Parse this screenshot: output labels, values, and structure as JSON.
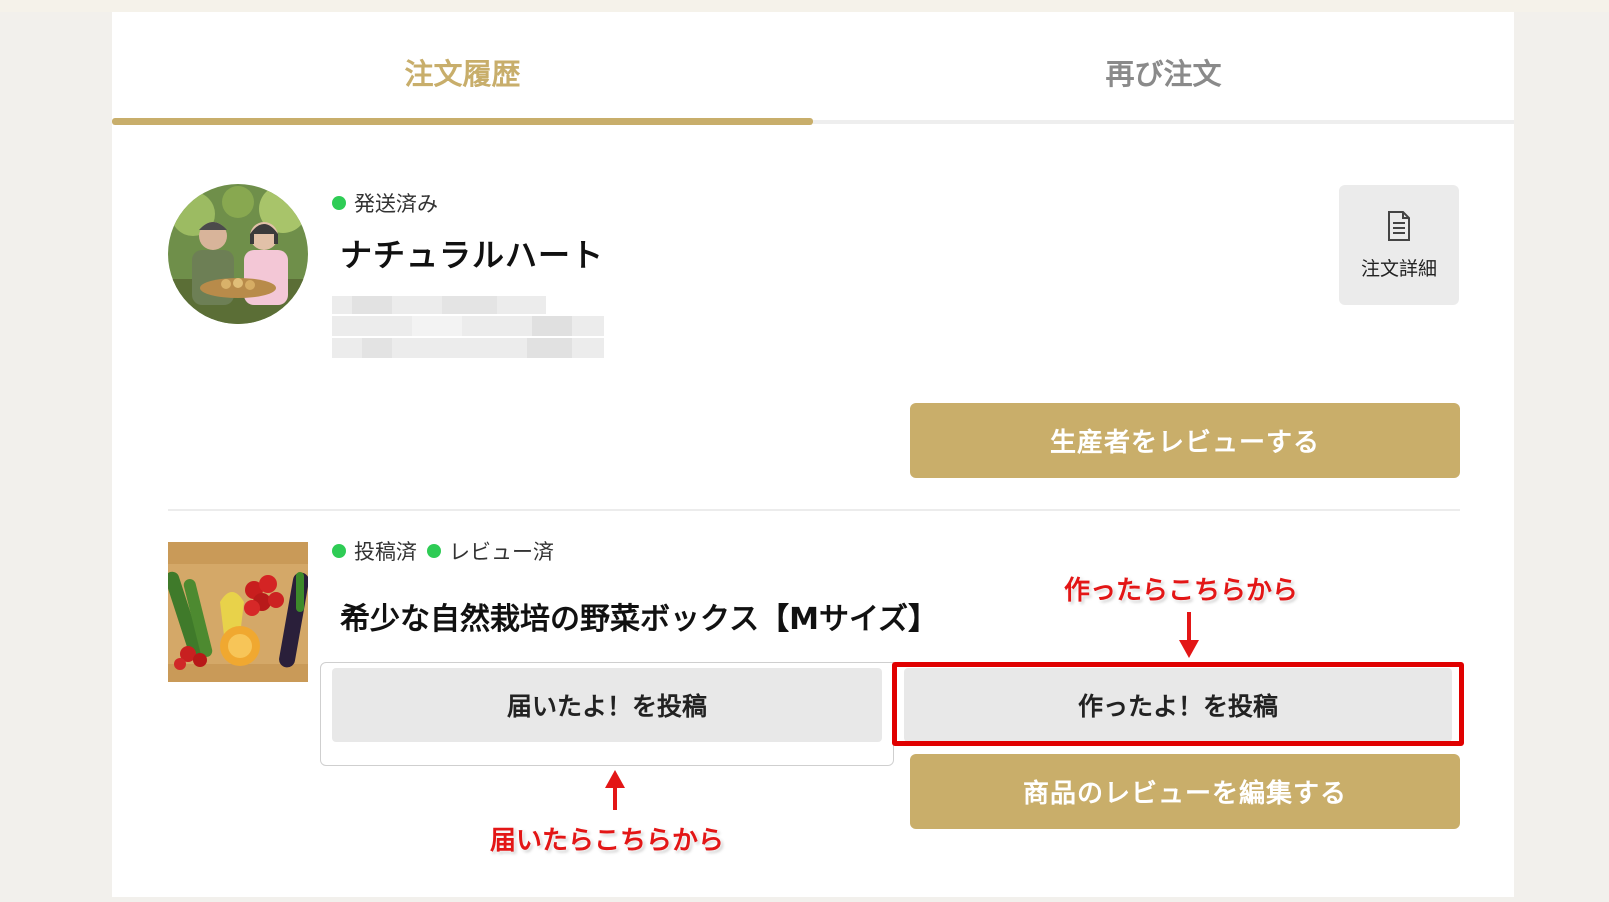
{
  "tabs": [
    {
      "label": "注文履歴",
      "active": true
    },
    {
      "label": "再び注文",
      "active": false
    }
  ],
  "order": {
    "status": {
      "label": "発送済み",
      "color": "#2ecc55"
    },
    "producer_name": "ナチュラルハート",
    "detail_button": {
      "label": "注文詳細",
      "icon": "document-icon"
    },
    "review_producer_button": "生産者をレビューする"
  },
  "product": {
    "statuses": [
      {
        "label": "投稿済",
        "color": "#2ecc55"
      },
      {
        "label": "レビュー済",
        "color": "#2ecc55"
      }
    ],
    "name": "希少な自然栽培の野菜ボックス【Mサイズ】",
    "post_delivered_button": "届いたよ！を投稿",
    "post_made_button": "作ったよ！を投稿",
    "edit_review_button": "商品のレビューを編集する"
  },
  "annotations": {
    "made": "作ったらこちらから",
    "delivered": "届いたらこちらから"
  },
  "colors": {
    "accent": "#c9ae6a",
    "highlight": "#e00000"
  }
}
